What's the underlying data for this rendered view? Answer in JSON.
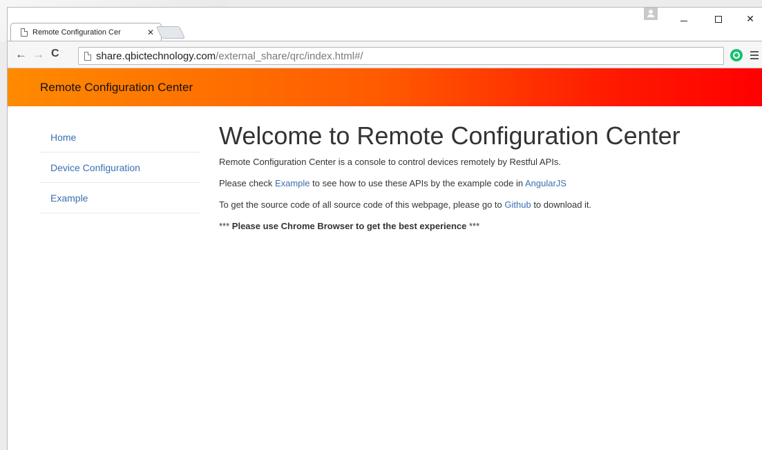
{
  "browser": {
    "tab_title": "Remote Configuration Cer",
    "tab_close": "✕",
    "url_host": "share.qbictechnology.com",
    "url_path": "/external_share/qrc/index.html#/",
    "window_minimize": "–",
    "window_close": "✕",
    "icons": {
      "back": "←",
      "forward": "→",
      "reload": "C",
      "star": "☆"
    }
  },
  "header": {
    "title": "Remote Configuration Center",
    "gradient_start": "#ff8a00",
    "gradient_end": "#ff0000"
  },
  "sidebar": {
    "items": [
      {
        "label": "Home"
      },
      {
        "label": "Device Configuration"
      },
      {
        "label": "Example"
      }
    ]
  },
  "main": {
    "title": "Welcome to Remote Configuration Center",
    "para1": "Remote Configuration Center is a console to control devices remotely by Restful APIs.",
    "para2_prefix": "Please check ",
    "para2_link1": "Example",
    "para2_mid": " to see how to use these APIs by the example code in ",
    "para2_link2": "AngularJS",
    "para3_prefix": "To get the source code of all source code of this webpage, please go to ",
    "para3_link": "Github",
    "para3_suffix": " to download it.",
    "para4_prefix": "*** ",
    "para4_bold": "Please use Chrome Browser to get the best experience",
    "para4_suffix": " ***"
  },
  "colors": {
    "link": "#3a6fb0",
    "text": "#333333"
  }
}
